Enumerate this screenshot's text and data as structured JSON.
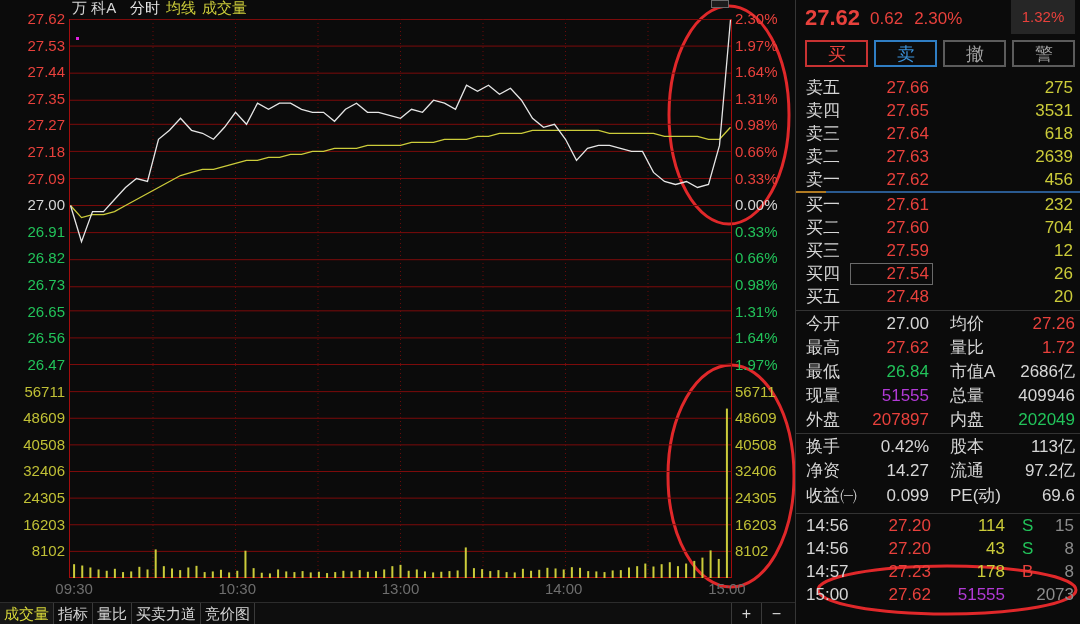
{
  "chart_header": {
    "stock_name": "万 科A"
  },
  "price_chart": {
    "percent_axis": [
      {
        "label": "2.30%",
        "kind": "up"
      },
      {
        "label": "1.97%",
        "kind": "up"
      },
      {
        "label": "1.64%",
        "kind": "up"
      },
      {
        "label": "1.31%",
        "kind": "up"
      },
      {
        "label": "0.98%",
        "kind": "up"
      },
      {
        "label": "0.66%",
        "kind": "up"
      },
      {
        "label": "0.33%",
        "kind": "up"
      },
      {
        "label": "0.00%",
        "kind": "flat"
      },
      {
        "label": "0.33%",
        "kind": "down"
      },
      {
        "label": "0.66%",
        "kind": "down"
      },
      {
        "label": "0.98%",
        "kind": "down"
      },
      {
        "label": "1.31%",
        "kind": "down"
      },
      {
        "label": "1.64%",
        "kind": "down"
      },
      {
        "label": "1.97%",
        "kind": "down"
      }
    ],
    "chart_data": {
      "type": "line",
      "categories": [
        null,
        null,
        null,
        null,
        null,
        null,
        null,
        null,
        null,
        null,
        null,
        null,
        null,
        null,
        null,
        null,
        null,
        null,
        null,
        null,
        null,
        null,
        null,
        null,
        null,
        null,
        null,
        null,
        null,
        null,
        null,
        null,
        null,
        null,
        null,
        null,
        null,
        null,
        null,
        null,
        null,
        null,
        null,
        null,
        null,
        null,
        null,
        null,
        null,
        null,
        null,
        null,
        null,
        null,
        null,
        null,
        null,
        null,
        null,
        null,
        null
      ],
      "ylim": [
        26.47,
        27.62
      ],
      "grid": true,
      "yticks": [
        {
          "value": 27.62,
          "label": "27.62"
        },
        {
          "value": 27.53,
          "label": "27.53"
        },
        {
          "value": 27.44,
          "label": "27.44"
        },
        {
          "value": 27.35,
          "label": "27.35"
        },
        {
          "value": 27.27,
          "label": "27.27"
        },
        {
          "value": 27.18,
          "label": "27.18"
        },
        {
          "value": 27.09,
          "label": "27.09"
        },
        {
          "value": 27.0,
          "label": "27.00"
        },
        {
          "value": 26.91,
          "label": "26.91"
        },
        {
          "value": 26.82,
          "label": "26.82"
        },
        {
          "value": 26.73,
          "label": "26.73"
        },
        {
          "value": 26.65,
          "label": "26.65"
        },
        {
          "value": 26.56,
          "label": "26.56"
        },
        {
          "value": 26.47,
          "label": "26.47"
        }
      ],
      "series": [
        {
          "name": "分时",
          "color": "#e6e6e6",
          "values": [
            27.0,
            26.88,
            26.98,
            26.98,
            27.02,
            27.06,
            27.09,
            27.08,
            27.22,
            27.25,
            27.29,
            27.25,
            27.24,
            27.22,
            27.26,
            27.31,
            27.27,
            27.34,
            27.32,
            27.34,
            27.34,
            27.32,
            27.31,
            27.31,
            27.28,
            27.32,
            27.34,
            27.31,
            27.31,
            27.3,
            27.29,
            27.32,
            27.31,
            27.35,
            27.34,
            27.32,
            27.4,
            27.38,
            27.4,
            27.37,
            27.39,
            27.35,
            27.29,
            27.26,
            27.27,
            27.22,
            27.15,
            27.19,
            27.2,
            27.2,
            27.19,
            27.18,
            27.18,
            27.11,
            27.08,
            27.07,
            27.08,
            27.06,
            27.07,
            27.2,
            27.62
          ]
        },
        {
          "name": "均线",
          "color": "#cccc3a",
          "values": [
            27.0,
            26.96,
            26.97,
            26.97,
            26.98,
            27.0,
            27.02,
            27.04,
            27.06,
            27.08,
            27.1,
            27.11,
            27.12,
            27.12,
            27.13,
            27.14,
            27.15,
            27.15,
            27.16,
            27.16,
            27.17,
            27.17,
            27.18,
            27.18,
            27.19,
            27.19,
            27.19,
            27.2,
            27.2,
            27.2,
            27.2,
            27.21,
            27.21,
            27.21,
            27.22,
            27.22,
            27.22,
            27.23,
            27.23,
            27.24,
            27.24,
            27.24,
            27.25,
            27.25,
            27.25,
            27.25,
            27.25,
            27.25,
            27.25,
            27.24,
            27.24,
            27.24,
            27.24,
            27.24,
            27.23,
            27.23,
            27.23,
            27.23,
            27.22,
            27.22,
            27.26
          ]
        }
      ]
    }
  },
  "volume_chart": {
    "right_axis": [
      "56711",
      "48609",
      "40508",
      "32406",
      "24305",
      "16203",
      "8102"
    ],
    "chart_data": {
      "type": "bar",
      "categories": [
        "09:30",
        null,
        null,
        null,
        null,
        null,
        null,
        null,
        null,
        null,
        null,
        null,
        null,
        null,
        null,
        null,
        null,
        null,
        null,
        null,
        "10:30",
        null,
        null,
        null,
        null,
        null,
        null,
        null,
        null,
        null,
        null,
        null,
        null,
        null,
        null,
        null,
        null,
        null,
        null,
        null,
        "13:00",
        null,
        null,
        null,
        null,
        null,
        null,
        null,
        null,
        null,
        null,
        null,
        null,
        null,
        null,
        null,
        null,
        null,
        null,
        null,
        "14:00",
        null,
        null,
        null,
        null,
        null,
        null,
        null,
        null,
        null,
        null,
        null,
        null,
        null,
        null,
        null,
        null,
        null,
        null,
        null,
        "15:00"
      ],
      "ylim": [
        0,
        64813
      ],
      "grid": true,
      "yticks": [
        {
          "value": 56711,
          "label": "56711"
        },
        {
          "value": 48609,
          "label": "48609"
        },
        {
          "value": 40508,
          "label": "40508"
        },
        {
          "value": 32406,
          "label": "32406"
        },
        {
          "value": 24305,
          "label": "24305"
        },
        {
          "value": 16203,
          "label": "16203"
        },
        {
          "value": 8102,
          "label": "8102"
        }
      ],
      "series": [
        {
          "name": "成交量",
          "color": "#cccc3a",
          "values": [
            4200,
            3800,
            3200,
            2600,
            2200,
            2800,
            1800,
            2000,
            3400,
            2600,
            8700,
            3600,
            2900,
            2400,
            3200,
            3700,
            1800,
            2000,
            2500,
            1700,
            2200,
            8300,
            3000,
            1600,
            1400,
            2600,
            2000,
            1800,
            2100,
            1700,
            1900,
            1500,
            1800,
            2200,
            2000,
            2400,
            1900,
            2100,
            2600,
            3600,
            4000,
            2200,
            2600,
            2000,
            1700,
            1900,
            2100,
            2300,
            9300,
            3000,
            2700,
            2100,
            2400,
            1800,
            1700,
            2800,
            2200,
            2500,
            3100,
            2900,
            2600,
            3300,
            3100,
            2100,
            2000,
            1800,
            2300,
            2400,
            3200,
            3600,
            4400,
            3500,
            4200,
            4800,
            3600,
            4400,
            5200,
            6200,
            8400,
            5800,
            51555
          ]
        }
      ]
    }
  },
  "bottom_tabs": [
    {
      "label": "成交量",
      "selected": true
    },
    {
      "label": "指标",
      "selected": false
    },
    {
      "label": "量比",
      "selected": false
    },
    {
      "label": "买卖力道",
      "selected": false
    },
    {
      "label": "竞价图",
      "selected": false
    }
  ],
  "zoom_buttons": [
    "+",
    "−"
  ],
  "quote": {
    "price": "27.62",
    "change": "0.62",
    "change_percent": "2.30%",
    "boxed_value": "1.32%"
  },
  "trade_buttons": [
    {
      "label": "买",
      "kind": "buy"
    },
    {
      "label": "卖",
      "kind": "sell"
    },
    {
      "label": "撤",
      "kind": "neutral"
    },
    {
      "label": "警",
      "kind": "neutral"
    }
  ],
  "order_book": {
    "asks": [
      {
        "label": "卖五",
        "price": "27.66",
        "volume": "275",
        "selected": false
      },
      {
        "label": "卖四",
        "price": "27.65",
        "volume": "3531",
        "selected": false
      },
      {
        "label": "卖三",
        "price": "27.64",
        "volume": "618",
        "selected": false
      },
      {
        "label": "卖二",
        "price": "27.63",
        "volume": "2639",
        "selected": false
      },
      {
        "label": "卖一",
        "price": "27.62",
        "volume": "456",
        "selected": false
      }
    ],
    "bids": [
      {
        "label": "买一",
        "price": "27.61",
        "volume": "232",
        "selected": false
      },
      {
        "label": "买二",
        "price": "27.60",
        "volume": "704",
        "selected": false
      },
      {
        "label": "买三",
        "price": "27.59",
        "volume": "12",
        "selected": false
      },
      {
        "label": "买四",
        "price": "27.54",
        "volume": "26",
        "selected": true
      },
      {
        "label": "买五",
        "price": "27.48",
        "volume": "20",
        "selected": false
      }
    ]
  },
  "stats": [
    {
      "items": [
        {
          "label": "今开",
          "value": "27.00",
          "color": "#d6d6d6"
        },
        {
          "label": "均价",
          "value": "27.26",
          "color": "#e8413c"
        },
        {
          "label": "最高",
          "value": "27.62",
          "color": "#e8413c"
        },
        {
          "label": "量比",
          "value": "1.72",
          "color": "#e8413c"
        },
        {
          "label": "最低",
          "value": "26.84",
          "color": "#22c35a"
        },
        {
          "label": "市值A",
          "value": "2686亿",
          "color": "#d6d6d6"
        },
        {
          "label": "现量",
          "value": "51555",
          "color": "#b23ad6"
        },
        {
          "label": "总量",
          "value": "409946",
          "color": "#d6d6d6"
        },
        {
          "label": "外盘",
          "value": "207897",
          "color": "#e8413c"
        },
        {
          "label": "内盘",
          "value": "202049",
          "color": "#22c35a"
        }
      ]
    },
    {
      "items": [
        {
          "label": "换手",
          "value": "0.42%",
          "color": "#d6d6d6"
        },
        {
          "label": "股本",
          "value": "113亿",
          "color": "#d6d6d6"
        },
        {
          "label": "净资",
          "value": "14.27",
          "color": "#d6d6d6"
        },
        {
          "label": "流通",
          "value": "97.2亿",
          "color": "#d6d6d6"
        },
        {
          "label": "收益㈠",
          "value": "0.099",
          "color": "#d6d6d6"
        },
        {
          "label": "PE(动)",
          "value": "69.6",
          "color": "#d6d6d6"
        }
      ]
    }
  ],
  "ticks": [
    {
      "time": "14:56",
      "price": "27.20",
      "volume": {
        "text": "114",
        "color": "#cccc3a"
      },
      "side": {
        "text": "S",
        "color": "#22c35a"
      },
      "count": "15"
    },
    {
      "time": "14:56",
      "price": "27.20",
      "volume": {
        "text": "43",
        "color": "#cccc3a"
      },
      "side": {
        "text": "S",
        "color": "#22c35a"
      },
      "count": "8"
    },
    {
      "time": "14:57",
      "price": "27.23",
      "volume": {
        "text": "178",
        "color": "#cccc3a"
      },
      "side": {
        "text": "B",
        "color": "#e8413c"
      },
      "count": "8"
    },
    {
      "time": "15:00",
      "price": "27.62",
      "volume": {
        "text": "51555",
        "color": "#b23ad6"
      },
      "count": "2073"
    }
  ]
}
